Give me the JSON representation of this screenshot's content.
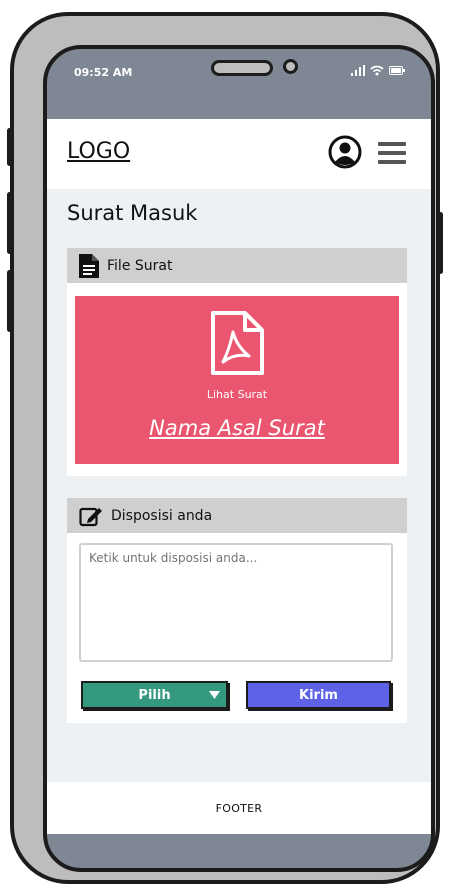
{
  "status_bar": {
    "time": "09:52 AM"
  },
  "header": {
    "logo": "LOGO"
  },
  "page": {
    "title": "Surat Masuk"
  },
  "file_card": {
    "heading": "File Surat",
    "view_label": "Lihat Surat",
    "sender_name": "Nama Asal Surat"
  },
  "disposition_card": {
    "heading": "Disposisi anda",
    "input_placeholder": "Ketik untuk disposisi anda...",
    "input_value": "",
    "select_label": "Pilih",
    "submit_label": "Kirim"
  },
  "footer": {
    "text": "FOOTER"
  },
  "colors": {
    "pdf_card": "#ea5670",
    "select_button": "#35997f",
    "submit_button": "#5e62e6",
    "card_header": "#cfcfcf",
    "screen_background": "#eef1f4"
  }
}
